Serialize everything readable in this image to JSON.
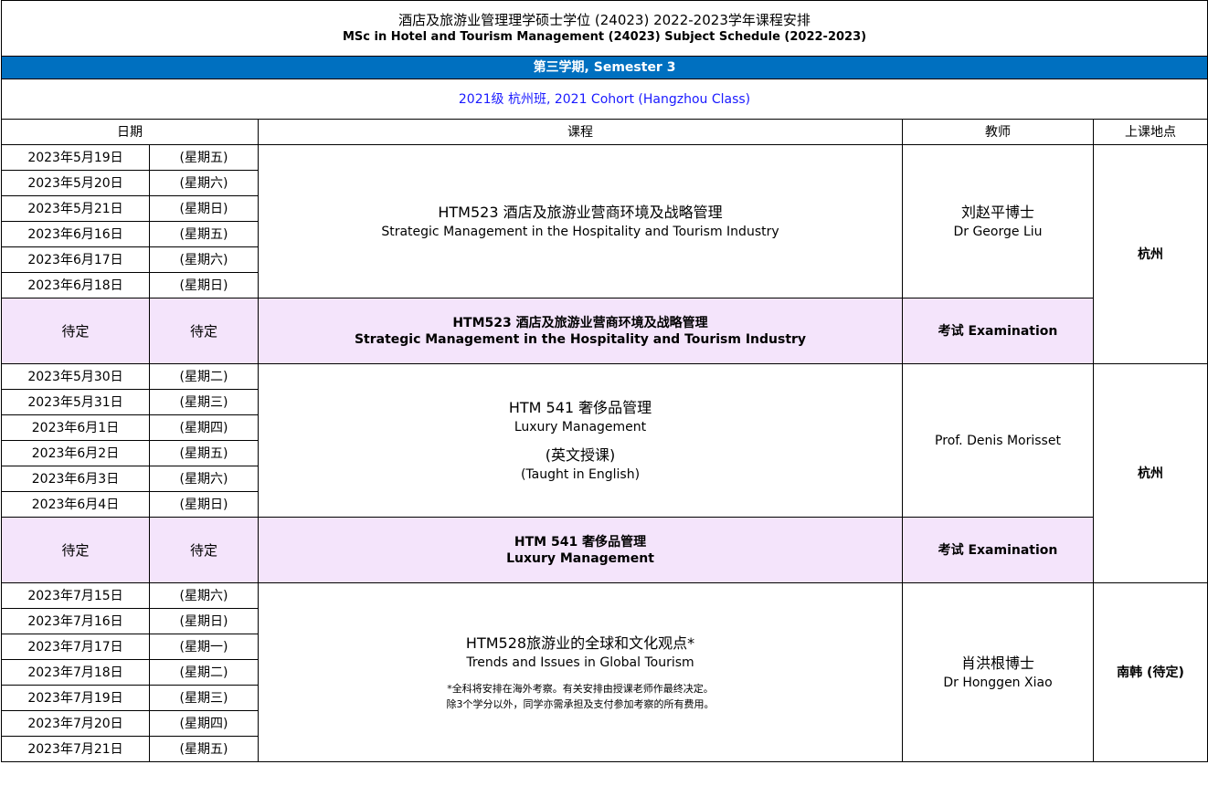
{
  "title": {
    "zh": "酒店及旅游业管理理学硕士学位 (24023) 2022-2023学年课程安排",
    "en": "MSc in Hotel and Tourism Management (24023) Subject Schedule (2022-2023)"
  },
  "semester": "第三学期, Semester 3",
  "cohort": "2021级 杭州班, 2021 Cohort (Hangzhou Class)",
  "headers": {
    "date": "日期",
    "course": "课程",
    "teacher": "教师",
    "location": "上课地点"
  },
  "block1": {
    "dates": [
      {
        "date": "2023年5月19日",
        "day": "(星期五)"
      },
      {
        "date": "2023年5月20日",
        "day": "(星期六)"
      },
      {
        "date": "2023年5月21日",
        "day": "(星期日)"
      },
      {
        "date": "2023年6月16日",
        "day": "(星期五)"
      },
      {
        "date": "2023年6月17日",
        "day": "(星期六)"
      },
      {
        "date": "2023年6月18日",
        "day": "(星期日)"
      }
    ],
    "course_zh": "HTM523 酒店及旅游业营商环境及战略管理",
    "course_en": "Strategic Management in the Hospitality and Tourism Industry",
    "teacher_zh": "刘赵平博士",
    "teacher_en": "Dr George Liu",
    "location": "杭州",
    "exam": {
      "date": "待定",
      "day": "待定",
      "course_zh": "HTM523 酒店及旅游业营商环境及战略管理",
      "course_en": "Strategic Management in the Hospitality and Tourism Industry",
      "teacher": "考试 Examination"
    }
  },
  "block2": {
    "dates": [
      {
        "date": "2023年5月30日",
        "day": "(星期二)"
      },
      {
        "date": "2023年5月31日",
        "day": "(星期三)"
      },
      {
        "date": "2023年6月1日",
        "day": "(星期四)"
      },
      {
        "date": "2023年6月2日",
        "day": "(星期五)"
      },
      {
        "date": "2023年6月3日",
        "day": "(星期六)"
      },
      {
        "date": "2023年6月4日",
        "day": "(星期日)"
      }
    ],
    "course_zh": "HTM 541 奢侈品管理",
    "course_en": "Luxury Management",
    "lang_zh": "(英文授课)",
    "lang_en": "(Taught in English)",
    "teacher": "Prof. Denis Morisset",
    "location": "杭州",
    "exam": {
      "date": "待定",
      "day": "待定",
      "course_zh": "HTM 541 奢侈品管理",
      "course_en": "Luxury Management",
      "teacher": "考试 Examination"
    }
  },
  "block3": {
    "dates": [
      {
        "date": "2023年7月15日",
        "day": "(星期六)"
      },
      {
        "date": "2023年7月16日",
        "day": "(星期日)"
      },
      {
        "date": "2023年7月17日",
        "day": "(星期一)"
      },
      {
        "date": "2023年7月18日",
        "day": "(星期二)"
      },
      {
        "date": "2023年7月19日",
        "day": "(星期三)"
      },
      {
        "date": "2023年7月20日",
        "day": "(星期四)"
      },
      {
        "date": "2023年7月21日",
        "day": "(星期五)"
      }
    ],
    "course_zh": "HTM528旅游业的全球和文化观点*",
    "course_en": "Trends and Issues in Global Tourism",
    "note1": "*全科将安排在海外考察。有关安排由授课老师作最终决定。",
    "note2": "除3个学分以外，同学亦需承担及支付参加考察的所有费用。",
    "teacher_zh": "肖洪根博士",
    "teacher_en": "Dr Honggen Xiao",
    "location": "南韩 (待定)"
  }
}
